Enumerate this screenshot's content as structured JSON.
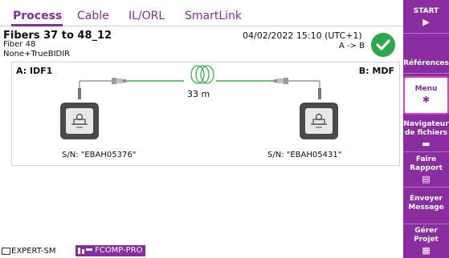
{
  "tabs": [
    {
      "label": "Process",
      "active": true
    },
    {
      "label": "Cable",
      "active": false
    },
    {
      "label": "IL/ORL",
      "active": false
    },
    {
      "label": "SmartLink",
      "active": false
    }
  ],
  "info": {
    "title": "Fibers 37 to 48_12",
    "fiber": "Fiber 48",
    "mode": "None+TrueBIDIR",
    "datetime": "04/02/2022 15:10 (UTC+1)",
    "direction": "A -> B",
    "status_icon": "check-circle-icon",
    "status_color": "#2aa84a"
  },
  "diagram": {
    "end_a": "A: IDF1",
    "end_b": "B: MDF",
    "distance": "33 m",
    "serial_a": "S/N: \"EBAH05376\"",
    "serial_b": "S/N: \"EBAH05431\"",
    "fiber_color": "#3cb24a"
  },
  "footer": {
    "expert_label": "EXPERT-SM",
    "fcomp_label": "FCOMP-PRO"
  },
  "sidebar": {
    "accent": "#8a2da0",
    "buttons": [
      {
        "label": "START",
        "icon": "play-icon",
        "glyph": "▶"
      },
      {
        "label": "Références",
        "icon": "",
        "glyph": ""
      },
      {
        "label": "Menu",
        "icon": "gear-icon",
        "glyph": "✱"
      },
      {
        "label": "Navigateur de fichiers",
        "icon": "folder-icon",
        "glyph": "▬"
      },
      {
        "label": "Faire Rapport",
        "icon": "report-icon",
        "glyph": "▤"
      },
      {
        "label": "Envoyer Message",
        "icon": "",
        "glyph": ""
      },
      {
        "label": "Gérer Projet",
        "icon": "project-icon",
        "glyph": "▦"
      }
    ]
  }
}
